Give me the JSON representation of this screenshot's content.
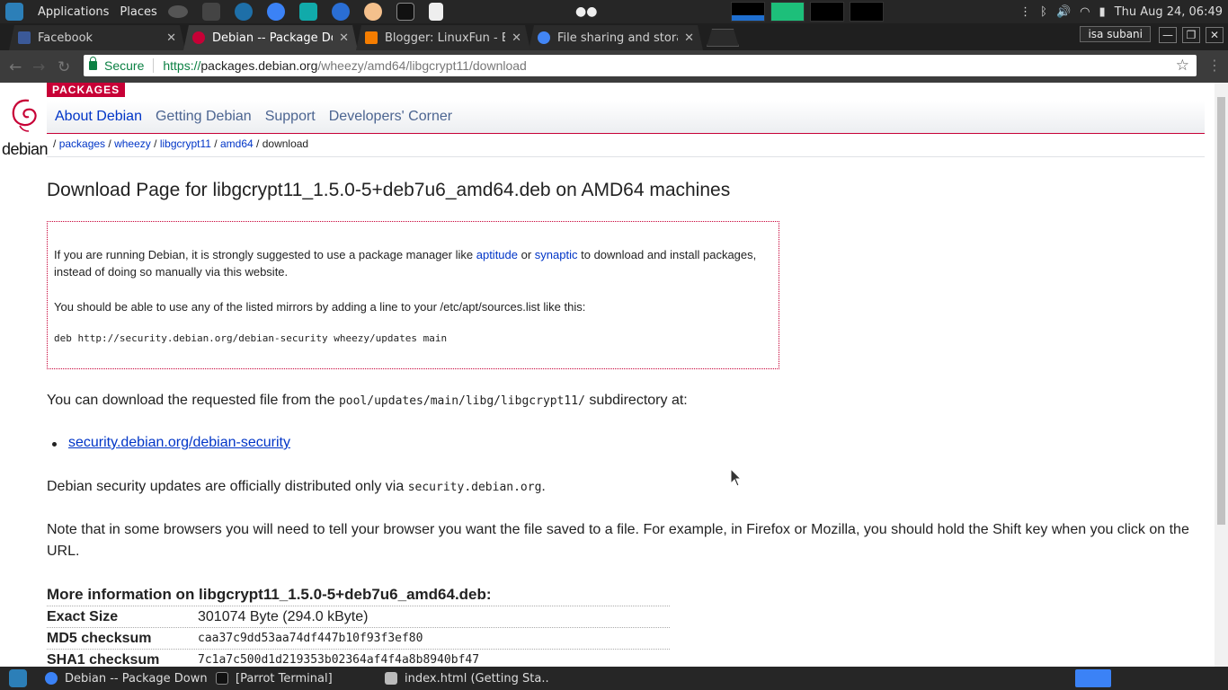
{
  "system_panel": {
    "menus": [
      "Applications",
      "Places"
    ],
    "clock": "Thu Aug 24, 06:49"
  },
  "tabs": [
    {
      "label": "Facebook",
      "active": false
    },
    {
      "label": "Debian -- Package Dow",
      "active": true
    },
    {
      "label": "Blogger: LinuxFun - Bl",
      "active": false
    },
    {
      "label": "File sharing and stora",
      "active": false
    }
  ],
  "user_chip": "isa subani",
  "window_buttons": {
    "minimize": "—",
    "maximize": "❐",
    "close": "✕"
  },
  "address_bar": {
    "secure_label": "Secure",
    "url_scheme": "https://",
    "url_host": "packages.debian.org",
    "url_path": "/wheezy/amd64/libgcrypt11/download"
  },
  "page": {
    "logo_text": "debian",
    "section_badge": "PACKAGES",
    "nav": [
      "About Debian",
      "Getting Debian",
      "Support",
      "Developers' Corner"
    ],
    "breadcrumb": {
      "sep": "/",
      "links": [
        "packages",
        "wheezy",
        "libgcrypt11",
        "amd64"
      ],
      "current": "download"
    },
    "title": "Download Page for libgcrypt11_1.5.0-5+deb7u6_amd64.deb on AMD64 machines",
    "notice": {
      "p1_before": "If you are running Debian, it is strongly suggested to use a package manager like ",
      "p1_link1": "aptitude",
      "p1_mid": " or ",
      "p1_link2": "synaptic",
      "p1_after": " to download and install packages, instead of doing so manually via this website.",
      "p2": "You should be able to use any of the listed mirrors by adding a line to your /etc/apt/sources.list like this:",
      "code": "deb http://security.debian.org/debian-security wheezy/updates main"
    },
    "download_intro_before": "You can download the requested file from the ",
    "download_intro_code": "pool/updates/main/libg/libgcrypt11/",
    "download_intro_after": " subdirectory at:",
    "mirror_link": "security.debian.org/debian-security",
    "security_before": "Debian security updates are officially distributed only via ",
    "security_code": "security.debian.org",
    "security_after": ".",
    "browser_note": "Note that in some browsers you will need to tell your browser you want the file saved to a file. For example, in Firefox or Mozilla, you should hold the Shift key when you click on the URL.",
    "more_info_title": "More information on libgcrypt11_1.5.0-5+deb7u6_amd64.deb:",
    "info_rows": [
      {
        "key": "Exact Size",
        "value": "301074 Byte (294.0 kByte)"
      },
      {
        "key": "MD5 checksum",
        "value": "caa37c9dd53aa74df447b10f93f3ef80"
      },
      {
        "key": "SHA1 checksum",
        "value": "7c1a7c500d1d219353b02364af4f4a8b8940bf47"
      }
    ]
  },
  "taskbar": [
    {
      "label": "Debian -- Package Down...",
      "active": false
    },
    {
      "label": "[Parrot Terminal]",
      "active": false
    },
    {
      "label": "index.html (Getting Sta...",
      "active": false
    }
  ],
  "colors": {
    "debian_red": "#c70036",
    "link_blue": "#0035c7",
    "secure_green": "#0b8043"
  }
}
